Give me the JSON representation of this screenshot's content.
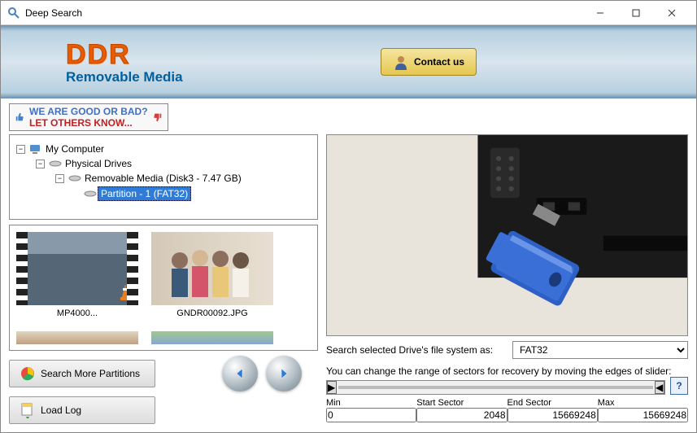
{
  "window": {
    "title": "Deep Search"
  },
  "banner": {
    "logo_main": "DDR",
    "logo_sub": "Removable Media",
    "contact": "Contact us"
  },
  "feedback": {
    "line1": "WE ARE GOOD OR BAD?",
    "line2": "LET OTHERS KNOW..."
  },
  "tree": {
    "root": "My Computer",
    "l1": "Physical Drives",
    "l2": "Removable Media (Disk3 - 7.47 GB)",
    "l3": "Partition - 1 (FAT32)"
  },
  "thumbs": [
    {
      "name": "MP4000...",
      "kind": "video"
    },
    {
      "name": "GNDR00092.JPG",
      "kind": "image"
    }
  ],
  "buttons": {
    "search_more": "Search More Partitions",
    "load_log": "Load Log"
  },
  "fs_label": "Search selected Drive's file system as:",
  "fs_value": "FAT32",
  "slider_hint": "You can change the range of sectors for recovery by moving the edges of slider:",
  "sectors": {
    "min_label": "Min",
    "min": "0",
    "start_label": "Start Sector",
    "start": "2048",
    "end_label": "End Sector",
    "end": "15669248",
    "max_label": "Max",
    "max": "15669248"
  }
}
